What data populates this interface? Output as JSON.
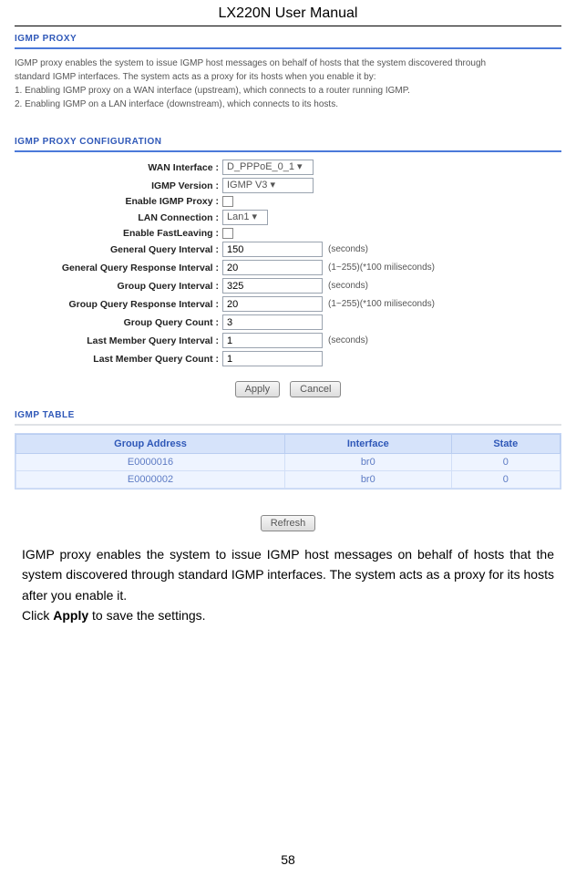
{
  "doc": {
    "title": "LX220N User Manual",
    "page_number": "58"
  },
  "screenshot": {
    "sec1": {
      "heading": "IGMP PROXY",
      "intro_l1": "IGMP proxy enables the system to issue IGMP host messages on behalf of hosts that the system discovered through",
      "intro_l2": "standard IGMP interfaces. The system acts as a proxy for its hosts when you enable it by:",
      "intro_l3": "1. Enabling IGMP proxy on a WAN interface (upstream), which connects to a router running IGMP.",
      "intro_l4": "2. Enabling IGMP on a LAN interface (downstream), which connects to its hosts."
    },
    "sec2": {
      "heading": "IGMP PROXY CONFIGURATION",
      "fields": {
        "wan_if": {
          "label": "WAN Interface",
          "value": "D_PPPoE_0_1"
        },
        "igmp_ver": {
          "label": "IGMP Version",
          "value": "IGMP V3"
        },
        "enable_proxy": {
          "label": "Enable IGMP Proxy",
          "checked": false
        },
        "lan_conn": {
          "label": "LAN Connection",
          "value": "Lan1"
        },
        "fastleave": {
          "label": "Enable FastLeaving",
          "checked": false
        },
        "gq_int": {
          "label": "General Query Interval",
          "value": "150",
          "unit": "(seconds)"
        },
        "gqr_int": {
          "label": "General Query Response Interval",
          "value": "20",
          "unit": "(1~255)(*100 miliseconds)"
        },
        "grp_int": {
          "label": "Group Query Interval",
          "value": "325",
          "unit": "(seconds)"
        },
        "grpr_int": {
          "label": "Group Query Response Interval",
          "value": "20",
          "unit": "(1~255)(*100 miliseconds)"
        },
        "grp_cnt": {
          "label": "Group Query Count",
          "value": "3"
        },
        "lmq_int": {
          "label": "Last Member Query Interval",
          "value": "1",
          "unit": "(seconds)"
        },
        "lmq_cnt": {
          "label": "Last Member Query Count",
          "value": "1"
        }
      },
      "buttons": {
        "apply": "Apply",
        "cancel": "Cancel"
      }
    },
    "sec3": {
      "heading": "IGMP TABLE",
      "cols": {
        "ga": "Group Address",
        "if": "Interface",
        "st": "State"
      },
      "rows": [
        {
          "ga": "E0000016",
          "if": "br0",
          "st": "0"
        },
        {
          "ga": "E0000002",
          "if": "br0",
          "st": "0"
        }
      ],
      "refresh": "Refresh"
    }
  },
  "body": {
    "p1": "IGMP proxy enables the system to issue IGMP host messages on behalf of hosts that the system discovered through standard IGMP interfaces. The system acts as a proxy for its hosts after you enable it.",
    "p2a": "Click ",
    "p2b": "Apply",
    "p2c": " to save the settings."
  }
}
